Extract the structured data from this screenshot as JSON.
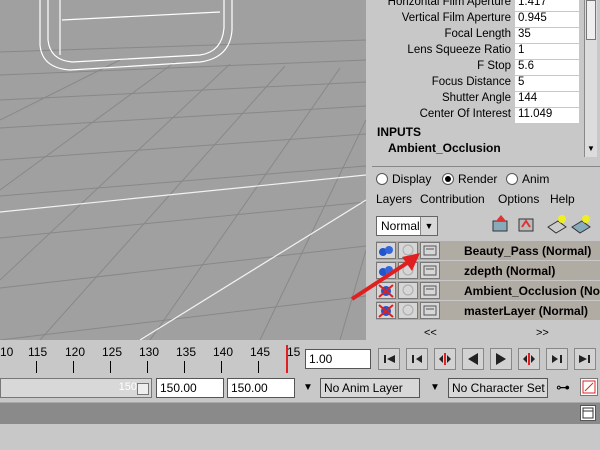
{
  "attributes": [
    {
      "label": "Horizontal Film Aperture",
      "value": "1.417"
    },
    {
      "label": "Vertical Film Aperture",
      "value": "0.945"
    },
    {
      "label": "Focal Length",
      "value": "35"
    },
    {
      "label": "Lens Squeeze Ratio",
      "value": "1"
    },
    {
      "label": "F Stop",
      "value": "5.6"
    },
    {
      "label": "Focus Distance",
      "value": "5"
    },
    {
      "label": "Shutter Angle",
      "value": "144"
    },
    {
      "label": "Center Of Interest",
      "value": "11.049"
    }
  ],
  "inputs": {
    "header": "INPUTS",
    "node": "Ambient_Occlusion"
  },
  "layer_editor": {
    "modes": [
      "Display",
      "Render",
      "Anim"
    ],
    "selected_mode": "Render",
    "menu": [
      "Layers",
      "Contribution",
      "Options",
      "Help"
    ],
    "blend_mode": "Normal",
    "layers": [
      {
        "name": "Beauty_Pass (Normal)"
      },
      {
        "name": "zdepth (Normal)"
      },
      {
        "name": "Ambient_Occlusion (Nor"
      },
      {
        "name": "masterLayer (Normal)"
      }
    ],
    "nav_prev": "<<",
    "nav_next": ">>"
  },
  "time_slider": {
    "ticks": [
      "10",
      "115",
      "120",
      "125",
      "130",
      "135",
      "140",
      "145",
      "15"
    ],
    "current_time": "1.00"
  },
  "range_slider": {
    "range_thumb_label": "150",
    "end_time": "150.00",
    "playback_end": "150.00",
    "anim_layer": "No Anim Layer",
    "character_set": "No Character Set"
  },
  "colors": {
    "highlight_red": "#e02020",
    "layer_row": "#b0aba3"
  }
}
